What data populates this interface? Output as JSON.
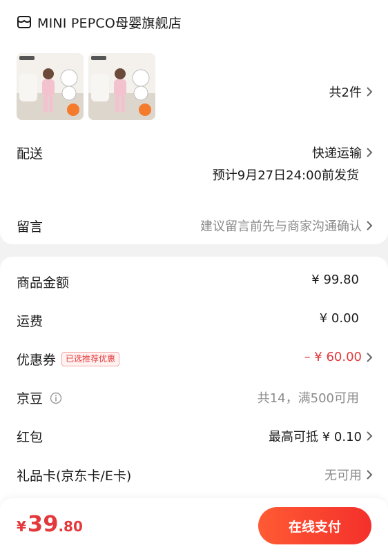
{
  "store": {
    "name": "MINI PEPCO母婴旗舰店",
    "icon": "store-icon"
  },
  "items": {
    "count_text": "共2件"
  },
  "delivery": {
    "label": "配送",
    "method": "快递运输",
    "estimate": "预计9月27日24:00前发货"
  },
  "message": {
    "label": "留言",
    "placeholder": "建议留言前先与商家沟通确认"
  },
  "summary": {
    "goods_label": "商品金额",
    "goods_value": "¥ 99.80",
    "shipping_label": "运费",
    "shipping_value": "¥ 0.00",
    "coupon_label": "优惠券",
    "coupon_badge": "已选推荐优惠",
    "coupon_value": "– ¥ 60.00",
    "jingdou_label": "京豆",
    "jingdou_value": "共14，满500可用",
    "redpacket_label": "红包",
    "redpacket_value": "最高可抵 ¥ 0.10",
    "giftcard_label": "礼品卡(京东卡/E卡)",
    "giftcard_value": "无可用"
  },
  "footer": {
    "currency": "¥",
    "total_int": "39",
    "total_dec": ".80",
    "pay_label": "在线支付"
  },
  "colors": {
    "accent": "#e4393c",
    "pay_gradient_start": "#ff5a34",
    "pay_gradient_end": "#f4302b"
  }
}
